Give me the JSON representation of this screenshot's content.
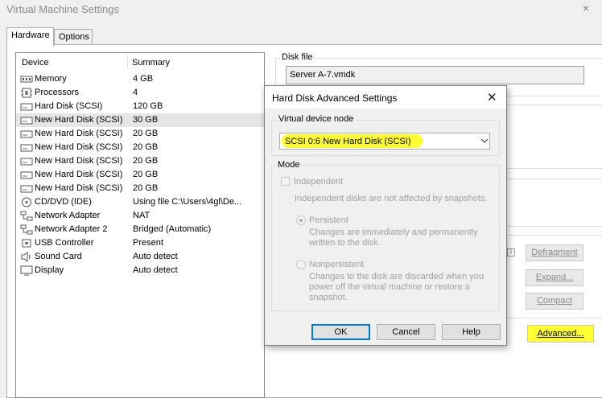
{
  "window": {
    "title": "Virtual Machine Settings"
  },
  "tabs": [
    {
      "label": "Hardware"
    },
    {
      "label": "Options"
    }
  ],
  "device_list": {
    "headers": [
      "Device",
      "Summary"
    ],
    "rows": [
      {
        "device": "Memory",
        "summary": "4 GB",
        "icon": "memory-icon"
      },
      {
        "device": "Processors",
        "summary": "4",
        "icon": "processor-icon"
      },
      {
        "device": "Hard Disk (SCSI)",
        "summary": "120 GB",
        "icon": "hard-disk-icon"
      },
      {
        "device": "New Hard Disk (SCSI)",
        "summary": "30 GB",
        "icon": "hard-disk-icon",
        "selected": true
      },
      {
        "device": "New Hard Disk (SCSI)",
        "summary": "20 GB",
        "icon": "hard-disk-icon"
      },
      {
        "device": "New Hard Disk (SCSI)",
        "summary": "20 GB",
        "icon": "hard-disk-icon"
      },
      {
        "device": "New Hard Disk (SCSI)",
        "summary": "20 GB",
        "icon": "hard-disk-icon"
      },
      {
        "device": "New Hard Disk (SCSI)",
        "summary": "20 GB",
        "icon": "hard-disk-icon"
      },
      {
        "device": "New Hard Disk (SCSI)",
        "summary": "20 GB",
        "icon": "hard-disk-icon"
      },
      {
        "device": "CD/DVD (IDE)",
        "summary": "Using file C:\\Users\\4gl\\De...",
        "icon": "cd-dvd-icon"
      },
      {
        "device": "Network Adapter",
        "summary": "NAT",
        "icon": "network-adapter-icon"
      },
      {
        "device": "Network Adapter 2",
        "summary": "Bridged (Automatic)",
        "icon": "network-adapter-icon"
      },
      {
        "device": "USB Controller",
        "summary": "Present",
        "icon": "usb-icon"
      },
      {
        "device": "Sound Card",
        "summary": "Auto detect",
        "icon": "sound-card-icon"
      },
      {
        "device": "Display",
        "summary": "Auto detect",
        "icon": "display-icon"
      }
    ]
  },
  "disk_file": {
    "legend": "Disk file",
    "value": "Server A-7.vmdk"
  },
  "utilities": {
    "defragment": "Defragment",
    "expand": "Expand...",
    "compact": "Compact",
    "advanced": "Advanced..."
  },
  "dialog": {
    "title": "Hard Disk Advanced Settings",
    "virtual_device_node": {
      "legend": "Virtual device node",
      "selected": "SCSI 0:6   New Hard Disk (SCSI)"
    },
    "mode": {
      "legend": "Mode",
      "independent_label": "Independent",
      "independent_desc": "Independent disks are not affected by snapshots.",
      "persistent_label": "Persistent",
      "persistent_desc_1": "Changes are immediately and permanently",
      "persistent_desc_2": "written to the disk.",
      "nonpersistent_label": "Nonpersistent",
      "nonpersistent_desc_1": "Changes to the disk are discarded when you",
      "nonpersistent_desc_2": "power off the virtual machine or restore a",
      "nonpersistent_desc_3": "snapshot."
    },
    "buttons": {
      "ok": "OK",
      "cancel": "Cancel",
      "help": "Help"
    }
  },
  "colors": {
    "highlight": "#ffff33",
    "selection": "#e5e5e5",
    "focus": "#0078d7"
  }
}
